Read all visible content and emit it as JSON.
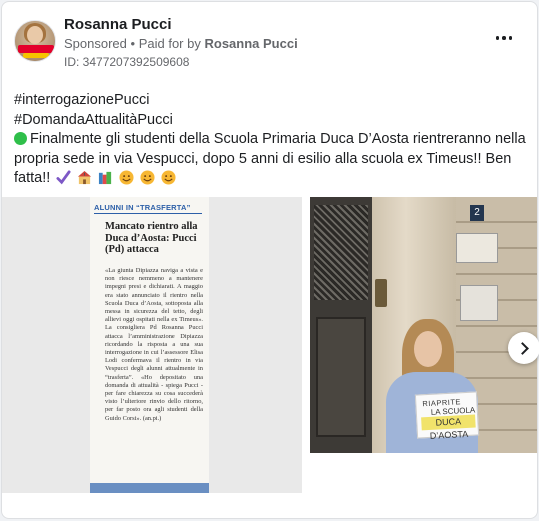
{
  "post": {
    "author_name": "Rosanna Pucci",
    "sponsored_label": "Sponsored",
    "paid_for_prefix": "Paid for by",
    "paid_for_name": "Rosanna Pucci",
    "separator": "•",
    "ad_id": "ID: 3477207392509608",
    "text_lines": [
      "#interrogazionePucci",
      "#DomandaAttualitàPucci",
      "Finalmente gli studenti della Scuola Primaria Duca D’Aosta rientreranno nella",
      "propria sede in via Vespucci, dopo 5 anni di esilio alla scuola ex Timeus!! Ben",
      "fatta!!"
    ],
    "emojis": [
      "check-mark-icon",
      "school-icon",
      "books-icon",
      "smile-icon",
      "smile-icon",
      "smile-icon"
    ]
  },
  "newspaper": {
    "section": "ALUNNI IN “TRASFERTA”",
    "headline": "Mancato rientro alla Duca d’Aosta: Pucci (Pd) attacca",
    "body": "«La giunta Dipiazza naviga a vista e non riesce nemmeno a mantenere impegni presi e dichiarati. A maggio era stato annunciato il rientro nella Scuola Duca d’Aosta, sottoposta alla messa in sicurezza del tetto, degli allievi oggi ospitati nella ex Timeus». La consigliera Pd Rosanna Pucci attacca l’amministrazione Dipiazza ricordando la risposta a una sua interrogazione in cui l’assessore Elisa Lodi confermava il rientro in via Vespucci degli alunni attualmente in “trasferta”. «Ho depositato una domanda di attualità - spiega Pucci - per fare chiarezza su cosa succederà visto l’ulteriore rinvio dello ritorno, per far posto ora agli studenti della Guido Corsi». (an.pi.)"
  },
  "photo": {
    "house_number": "2",
    "sign_line1": "RIAPRITE",
    "sign_line2": "LA SCUOLA",
    "sign_line3": "DUCA D’AOSTA"
  }
}
